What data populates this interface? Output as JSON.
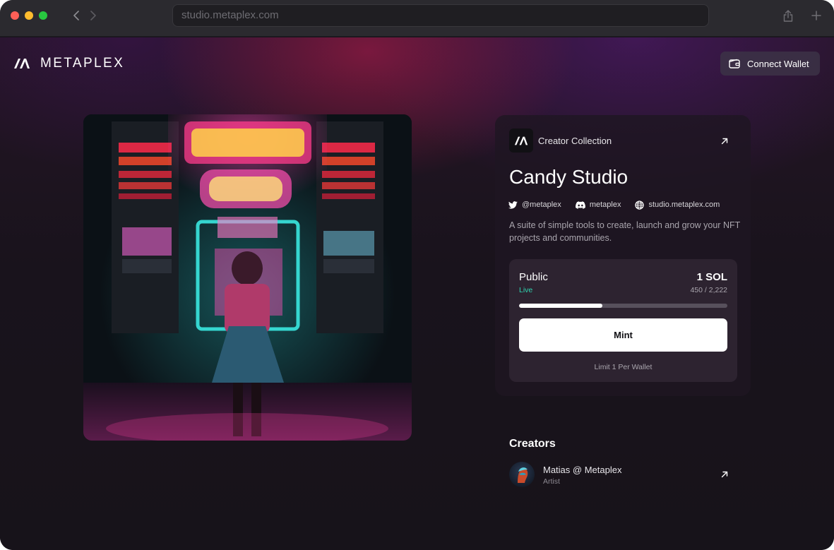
{
  "browser": {
    "url": "studio.metaplex.com"
  },
  "header": {
    "logo_text": "METAPLEX",
    "connect_label": "Connect Wallet"
  },
  "collection": {
    "label": "Creator Collection",
    "title": "Candy Studio",
    "socials": [
      {
        "icon": "twitter-icon",
        "label": "@metaplex"
      },
      {
        "icon": "discord-icon",
        "label": "metaplex"
      },
      {
        "icon": "globe-icon",
        "label": "studio.metaplex.com"
      }
    ],
    "description": "A suite of simple tools to create, launch and grow your NFT projects and communities."
  },
  "mint_phase": {
    "name": "Public",
    "status": "Live",
    "price": "1 SOL",
    "count": "450 / 2,222",
    "progress_fraction": 0.4,
    "mint_label": "Mint",
    "limit": "Limit 1 Per Wallet"
  },
  "creators": {
    "title": "Creators",
    "items": [
      {
        "name": "Matias @ Metaplex",
        "role": "Artist"
      }
    ]
  },
  "colors": {
    "accent_live": "#2fd4b0",
    "button_bg": "#ffffff",
    "page_bg": "#18141c"
  }
}
